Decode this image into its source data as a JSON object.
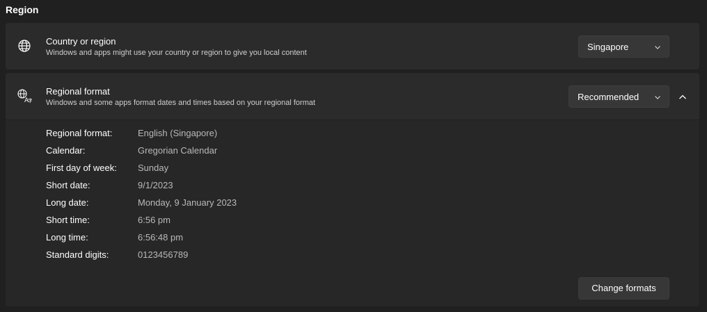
{
  "section": {
    "title": "Region"
  },
  "country": {
    "icon": "globe-icon",
    "title": "Country or region",
    "description": "Windows and apps might use your country or region to give you local content",
    "selected": "Singapore"
  },
  "regional_format": {
    "icon": "language-format-icon",
    "title": "Regional format",
    "description": "Windows and some apps format dates and times based on your regional format",
    "selected": "Recommended",
    "expanded": true,
    "details": [
      {
        "label": "Regional format:",
        "value": "English (Singapore)"
      },
      {
        "label": "Calendar:",
        "value": "Gregorian Calendar"
      },
      {
        "label": "First day of week:",
        "value": "Sunday"
      },
      {
        "label": "Short date:",
        "value": "9/1/2023"
      },
      {
        "label": "Long date:",
        "value": "Monday, 9 January 2023"
      },
      {
        "label": "Short time:",
        "value": "6:56 pm"
      },
      {
        "label": "Long time:",
        "value": "6:56:48 pm"
      },
      {
        "label": "Standard digits:",
        "value": "0123456789"
      }
    ],
    "change_button": "Change formats"
  },
  "colors": {
    "background": "#202020",
    "card": "#2b2b2b",
    "text": "#ffffff",
    "secondary_text": "#b9b9b9"
  }
}
